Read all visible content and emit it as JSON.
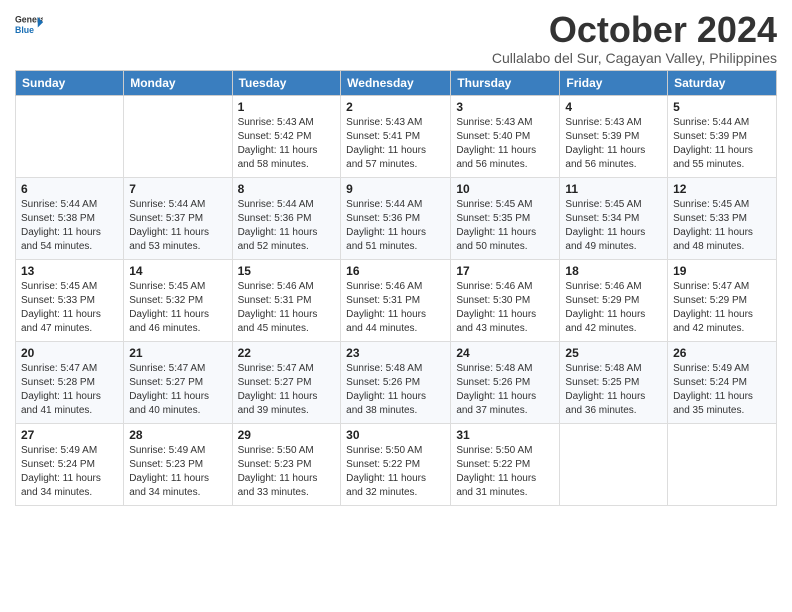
{
  "logo": {
    "line1": "General",
    "line2": "Blue"
  },
  "title": "October 2024",
  "subtitle": "Cullalabo del Sur, Cagayan Valley, Philippines",
  "header_days": [
    "Sunday",
    "Monday",
    "Tuesday",
    "Wednesday",
    "Thursday",
    "Friday",
    "Saturday"
  ],
  "weeks": [
    [
      {
        "day": "",
        "info": ""
      },
      {
        "day": "",
        "info": ""
      },
      {
        "day": "1",
        "info": "Sunrise: 5:43 AM\nSunset: 5:42 PM\nDaylight: 11 hours and 58 minutes."
      },
      {
        "day": "2",
        "info": "Sunrise: 5:43 AM\nSunset: 5:41 PM\nDaylight: 11 hours and 57 minutes."
      },
      {
        "day": "3",
        "info": "Sunrise: 5:43 AM\nSunset: 5:40 PM\nDaylight: 11 hours and 56 minutes."
      },
      {
        "day": "4",
        "info": "Sunrise: 5:43 AM\nSunset: 5:39 PM\nDaylight: 11 hours and 56 minutes."
      },
      {
        "day": "5",
        "info": "Sunrise: 5:44 AM\nSunset: 5:39 PM\nDaylight: 11 hours and 55 minutes."
      }
    ],
    [
      {
        "day": "6",
        "info": "Sunrise: 5:44 AM\nSunset: 5:38 PM\nDaylight: 11 hours and 54 minutes."
      },
      {
        "day": "7",
        "info": "Sunrise: 5:44 AM\nSunset: 5:37 PM\nDaylight: 11 hours and 53 minutes."
      },
      {
        "day": "8",
        "info": "Sunrise: 5:44 AM\nSunset: 5:36 PM\nDaylight: 11 hours and 52 minutes."
      },
      {
        "day": "9",
        "info": "Sunrise: 5:44 AM\nSunset: 5:36 PM\nDaylight: 11 hours and 51 minutes."
      },
      {
        "day": "10",
        "info": "Sunrise: 5:45 AM\nSunset: 5:35 PM\nDaylight: 11 hours and 50 minutes."
      },
      {
        "day": "11",
        "info": "Sunrise: 5:45 AM\nSunset: 5:34 PM\nDaylight: 11 hours and 49 minutes."
      },
      {
        "day": "12",
        "info": "Sunrise: 5:45 AM\nSunset: 5:33 PM\nDaylight: 11 hours and 48 minutes."
      }
    ],
    [
      {
        "day": "13",
        "info": "Sunrise: 5:45 AM\nSunset: 5:33 PM\nDaylight: 11 hours and 47 minutes."
      },
      {
        "day": "14",
        "info": "Sunrise: 5:45 AM\nSunset: 5:32 PM\nDaylight: 11 hours and 46 minutes."
      },
      {
        "day": "15",
        "info": "Sunrise: 5:46 AM\nSunset: 5:31 PM\nDaylight: 11 hours and 45 minutes."
      },
      {
        "day": "16",
        "info": "Sunrise: 5:46 AM\nSunset: 5:31 PM\nDaylight: 11 hours and 44 minutes."
      },
      {
        "day": "17",
        "info": "Sunrise: 5:46 AM\nSunset: 5:30 PM\nDaylight: 11 hours and 43 minutes."
      },
      {
        "day": "18",
        "info": "Sunrise: 5:46 AM\nSunset: 5:29 PM\nDaylight: 11 hours and 42 minutes."
      },
      {
        "day": "19",
        "info": "Sunrise: 5:47 AM\nSunset: 5:29 PM\nDaylight: 11 hours and 42 minutes."
      }
    ],
    [
      {
        "day": "20",
        "info": "Sunrise: 5:47 AM\nSunset: 5:28 PM\nDaylight: 11 hours and 41 minutes."
      },
      {
        "day": "21",
        "info": "Sunrise: 5:47 AM\nSunset: 5:27 PM\nDaylight: 11 hours and 40 minutes."
      },
      {
        "day": "22",
        "info": "Sunrise: 5:47 AM\nSunset: 5:27 PM\nDaylight: 11 hours and 39 minutes."
      },
      {
        "day": "23",
        "info": "Sunrise: 5:48 AM\nSunset: 5:26 PM\nDaylight: 11 hours and 38 minutes."
      },
      {
        "day": "24",
        "info": "Sunrise: 5:48 AM\nSunset: 5:26 PM\nDaylight: 11 hours and 37 minutes."
      },
      {
        "day": "25",
        "info": "Sunrise: 5:48 AM\nSunset: 5:25 PM\nDaylight: 11 hours and 36 minutes."
      },
      {
        "day": "26",
        "info": "Sunrise: 5:49 AM\nSunset: 5:24 PM\nDaylight: 11 hours and 35 minutes."
      }
    ],
    [
      {
        "day": "27",
        "info": "Sunrise: 5:49 AM\nSunset: 5:24 PM\nDaylight: 11 hours and 34 minutes."
      },
      {
        "day": "28",
        "info": "Sunrise: 5:49 AM\nSunset: 5:23 PM\nDaylight: 11 hours and 34 minutes."
      },
      {
        "day": "29",
        "info": "Sunrise: 5:50 AM\nSunset: 5:23 PM\nDaylight: 11 hours and 33 minutes."
      },
      {
        "day": "30",
        "info": "Sunrise: 5:50 AM\nSunset: 5:22 PM\nDaylight: 11 hours and 32 minutes."
      },
      {
        "day": "31",
        "info": "Sunrise: 5:50 AM\nSunset: 5:22 PM\nDaylight: 11 hours and 31 minutes."
      },
      {
        "day": "",
        "info": ""
      },
      {
        "day": "",
        "info": ""
      }
    ]
  ]
}
